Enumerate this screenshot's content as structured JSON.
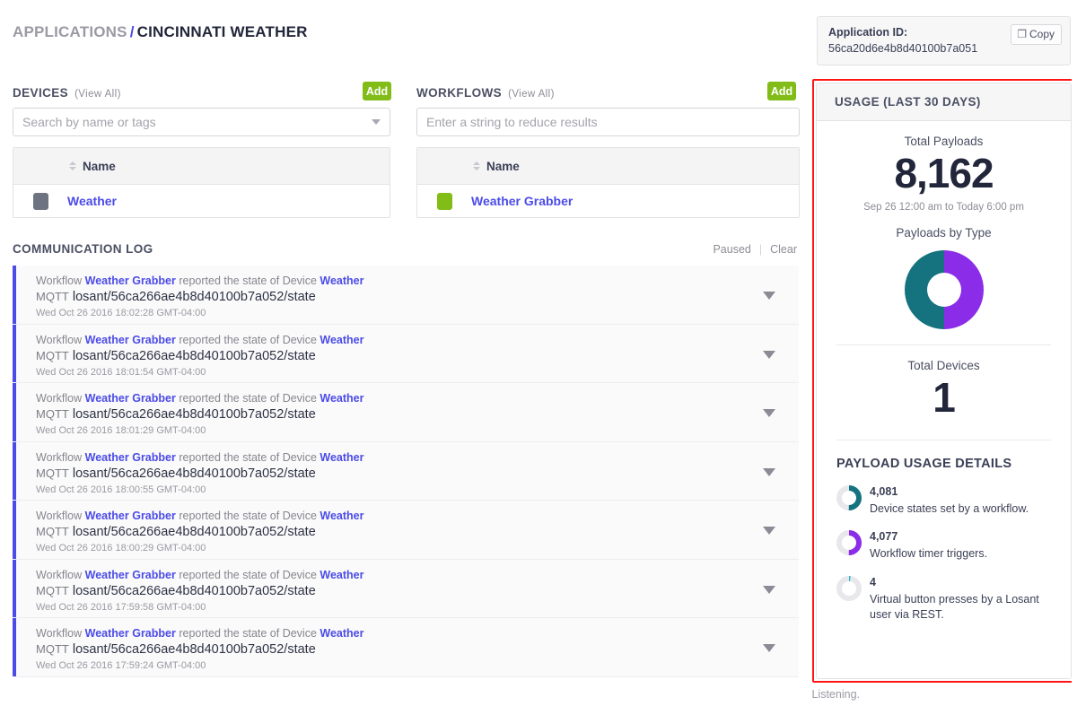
{
  "breadcrumb": {
    "root": "APPLICATIONS",
    "separator": "/",
    "current": "CINCINNATI WEATHER"
  },
  "app_id_card": {
    "label": "Application ID:",
    "value": "56ca20d6e4b8d40100b7a051",
    "copy_label": "Copy",
    "copy_icon": "copy-icon"
  },
  "devices": {
    "title": "DEVICES",
    "view_all": "(View All)",
    "add_label": "Add",
    "search_placeholder": "Search by name or tags",
    "search_value": "",
    "column_header": "Name",
    "rows": [
      {
        "name": "Weather",
        "swatch_color": "#6e7382"
      }
    ]
  },
  "workflows": {
    "title": "WORKFLOWS",
    "view_all": "(View All)",
    "add_label": "Add",
    "search_placeholder": "Enter a string to reduce results",
    "search_value": "",
    "column_header": "Name",
    "rows": [
      {
        "name": "Weather Grabber",
        "swatch_color": "#82bc17"
      }
    ]
  },
  "communication_log": {
    "title": "COMMUNICATION LOG",
    "paused_label": "Paused",
    "clear_label": "Clear",
    "status": "Listening.",
    "entries": [
      {
        "prefix": "Workflow",
        "workflow": "Weather Grabber",
        "middle": "reported the state of Device",
        "device": "Weather",
        "protocol": "MQTT",
        "topic": "losant/56ca266ae4b8d40100b7a052/state",
        "timestamp": "Wed Oct 26 2016 18:02:28 GMT-04:00"
      },
      {
        "prefix": "Workflow",
        "workflow": "Weather Grabber",
        "middle": "reported the state of Device",
        "device": "Weather",
        "protocol": "MQTT",
        "topic": "losant/56ca266ae4b8d40100b7a052/state",
        "timestamp": "Wed Oct 26 2016 18:01:54 GMT-04:00"
      },
      {
        "prefix": "Workflow",
        "workflow": "Weather Grabber",
        "middle": "reported the state of Device",
        "device": "Weather",
        "protocol": "MQTT",
        "topic": "losant/56ca266ae4b8d40100b7a052/state",
        "timestamp": "Wed Oct 26 2016 18:01:29 GMT-04:00"
      },
      {
        "prefix": "Workflow",
        "workflow": "Weather Grabber",
        "middle": "reported the state of Device",
        "device": "Weather",
        "protocol": "MQTT",
        "topic": "losant/56ca266ae4b8d40100b7a052/state",
        "timestamp": "Wed Oct 26 2016 18:00:55 GMT-04:00"
      },
      {
        "prefix": "Workflow",
        "workflow": "Weather Grabber",
        "middle": "reported the state of Device",
        "device": "Weather",
        "protocol": "MQTT",
        "topic": "losant/56ca266ae4b8d40100b7a052/state",
        "timestamp": "Wed Oct 26 2016 18:00:29 GMT-04:00"
      },
      {
        "prefix": "Workflow",
        "workflow": "Weather Grabber",
        "middle": "reported the state of Device",
        "device": "Weather",
        "protocol": "MQTT",
        "topic": "losant/56ca266ae4b8d40100b7a052/state",
        "timestamp": "Wed Oct 26 2016 17:59:58 GMT-04:00"
      },
      {
        "prefix": "Workflow",
        "workflow": "Weather Grabber",
        "middle": "reported the state of Device",
        "device": "Weather",
        "protocol": "MQTT",
        "topic": "losant/56ca266ae4b8d40100b7a052/state",
        "timestamp": "Wed Oct 26 2016 17:59:24 GMT-04:00"
      }
    ]
  },
  "usage": {
    "header": "USAGE (LAST 30 DAYS)",
    "total_payloads_label": "Total Payloads",
    "total_payloads_value": "8,162",
    "date_range": "Sep 26 12:00 am to Today 6:00 pm",
    "payloads_by_type_label": "Payloads by Type",
    "total_devices_label": "Total Devices",
    "total_devices_value": "1",
    "details_title": "PAYLOAD USAGE DETAILS",
    "details": [
      {
        "value": "4,081",
        "description": "Device states set by a workflow.",
        "color": "#15727f",
        "fraction": 0.5
      },
      {
        "value": "4,077",
        "description": "Workflow timer triggers.",
        "color": "#8b2ce8",
        "fraction": 0.5
      },
      {
        "value": "4",
        "description": "Virtual button presses by a Losant user via REST.",
        "color": "#29b6c9",
        "fraction": 0.02
      }
    ]
  },
  "chart_data": {
    "type": "pie",
    "title": "Payloads by Type",
    "labels": [
      "Device states set by a workflow.",
      "Workflow timer triggers.",
      "Virtual button presses by a Losant user via REST."
    ],
    "values": [
      4081,
      4077,
      4
    ],
    "colors": [
      "#15727f",
      "#8b2ce8",
      "#29b6c9"
    ],
    "total": 8162,
    "legend": "below",
    "donut": true,
    "inner_radius_ratio": 0.42
  },
  "colors": {
    "accent_blue": "#4b4be8",
    "accent_green": "#82bc17",
    "teal": "#15727f",
    "purple": "#8b2ce8",
    "cyan": "#29b6c9",
    "highlight_red": "#ff1515"
  }
}
